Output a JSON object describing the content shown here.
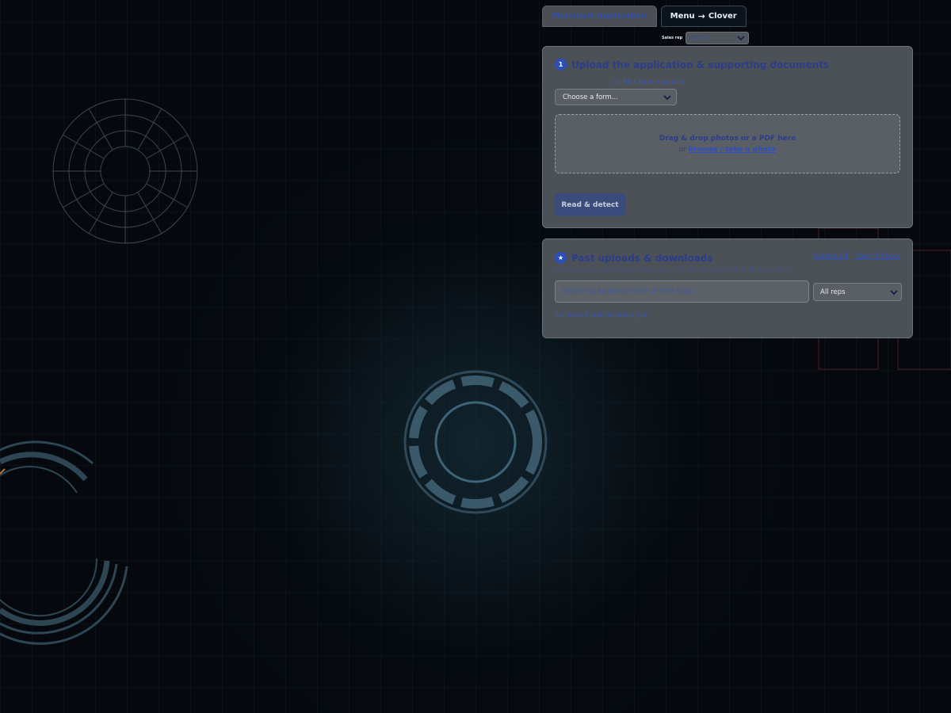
{
  "tabs": [
    {
      "label": "Merchant Application",
      "active": false
    },
    {
      "label": "Menu",
      "arrow": "→",
      "label2": "Clover",
      "active": true
    }
  ],
  "sales_rep": {
    "label": "Sales rep",
    "placeholder": "Select rep..."
  },
  "upload_card": {
    "step": "1",
    "title": "Upload the application & supporting documents",
    "fill_manual": "Or fill a form manually",
    "form_select": "Choose a form...",
    "dropzone": {
      "main": "Drag & drop photos or a PDF here",
      "or": "or",
      "link": "browse / take a photo"
    },
    "read_button": "Read & detect"
  },
  "history_card": {
    "icon": "★",
    "title": "Past uploads & downloads",
    "export_all": "Export all",
    "clear_history": "Clear history",
    "hint": "Shared across your team's devices. Click one to reopen and fill more forms.",
    "search_placeholder": "Search by business name or form type...",
    "reps_filter": "All reps",
    "empty": "No saved submissions yet"
  },
  "colors": {
    "accent": "#2c4fb8",
    "link": "#2f4fc2",
    "card": "#4c5057",
    "background": "#05090d"
  }
}
